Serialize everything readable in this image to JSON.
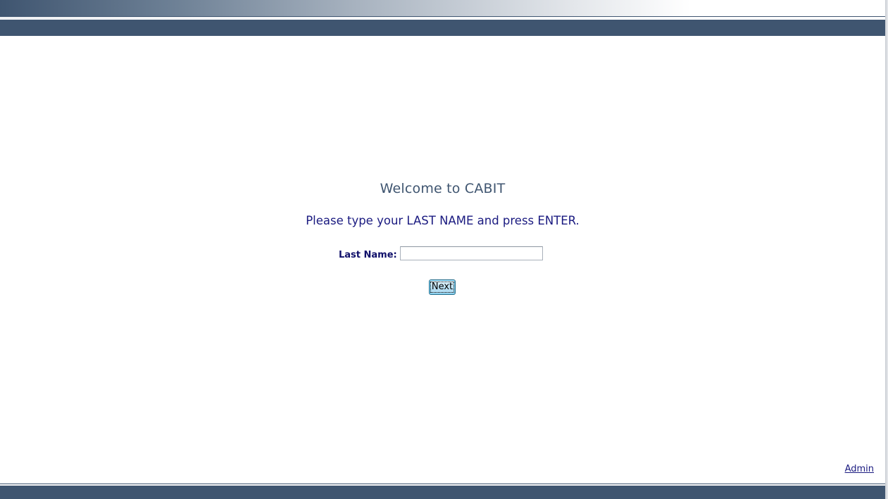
{
  "main": {
    "welcome": "Welcome to CABIT",
    "instruction": "Please type your LAST NAME and press ENTER.",
    "last_name_label": "Last Name:",
    "last_name_value": "",
    "next_label": "Next"
  },
  "footer": {
    "admin_label": "Admin"
  },
  "colors": {
    "header_bar": "#3f5570",
    "text_navy": "#1a1a80",
    "welcome_text": "#3f5570"
  }
}
